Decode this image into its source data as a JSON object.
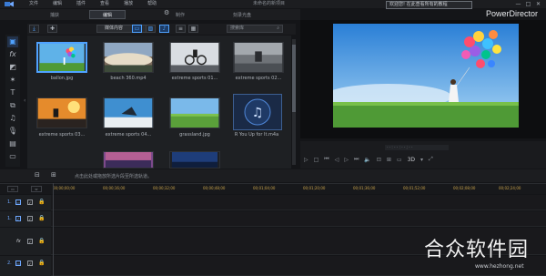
{
  "app": {
    "menu": [
      "文件",
      "编辑",
      "插件",
      "查看",
      "播放",
      "帮助"
    ],
    "project_title": "未命名的新项目",
    "help_box": "欢迎您! 在此查看所有的教程",
    "brand": "PowerDirector",
    "window_controls": [
      "—",
      "□",
      "✕"
    ]
  },
  "modes": {
    "capture": "捕获",
    "edit": "编辑",
    "produce": "制作",
    "create_disc": "刻录光盘"
  },
  "toolbar": {
    "filter_selected": "媒体内容",
    "search_placeholder": "搜索库"
  },
  "media": [
    {
      "name": "ballon.jpg",
      "selected": true
    },
    {
      "name": "beach 360.mp4",
      "selected": false
    },
    {
      "name": "extreme sports 01...",
      "selected": false
    },
    {
      "name": "extreme sports 02...",
      "selected": false
    },
    {
      "name": "extreme sports 03...",
      "selected": false
    },
    {
      "name": "extreme sports 04...",
      "selected": false
    },
    {
      "name": "grassland.jpg",
      "selected": false
    },
    {
      "name": "R You Up for It.m4a",
      "selected": false
    }
  ],
  "preview": {
    "mode_3d": "3D",
    "timecode": "- - : - - : - - ; - -"
  },
  "timeline": {
    "hint": "点击此处或拖放所选片段至所选轨道。",
    "ruler": [
      "00;00;00;00",
      "00;00;16;00",
      "00;00;32;00",
      "00;00;48;00",
      "00;01;04;00",
      "00;01;20;00",
      "00;01;36;00",
      "00;01;52;00",
      "00;02;08;00",
      "00;02;24;00"
    ],
    "tracks": [
      {
        "label": "1.",
        "icon": "video-track-icon"
      },
      {
        "label": "1.",
        "icon": "audio-track-icon"
      },
      {
        "label": "",
        "icon": "fx-track-icon"
      },
      {
        "label": "2.",
        "icon": "video-track-icon"
      }
    ]
  },
  "watermark": {
    "text": "合众软件园",
    "sub": "www.hezhong.net"
  }
}
